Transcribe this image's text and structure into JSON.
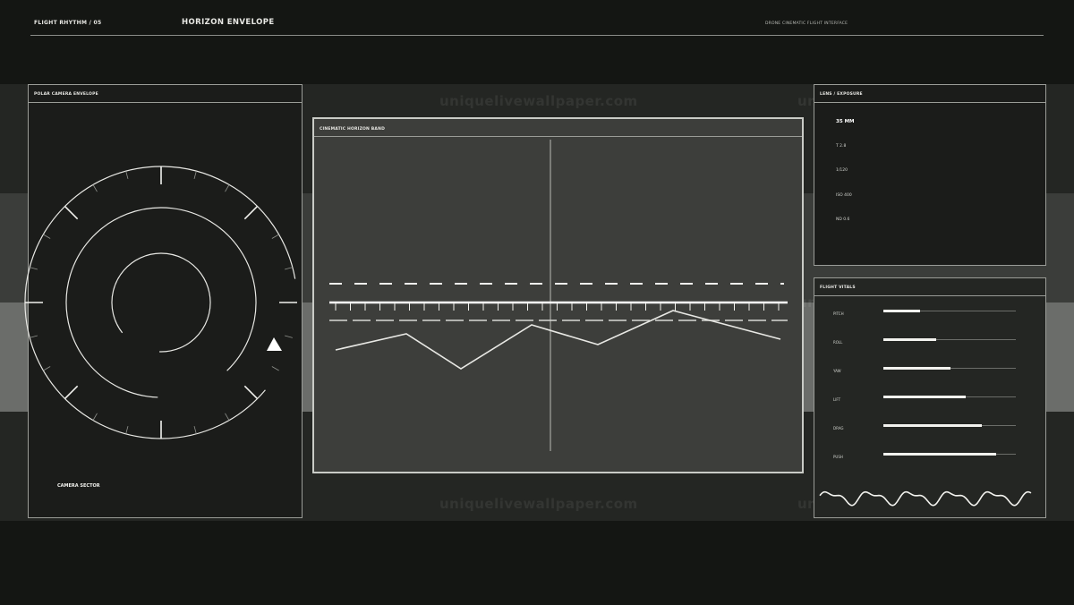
{
  "header": {
    "left_label": "FLIGHT RHYTHM / 05",
    "title": "HORIZON ENVELOPE",
    "right_label": "DRONE CINEMATIC FLIGHT INTERFACE"
  },
  "polar_panel": {
    "title": "POLAR CAMERA ENVELOPE",
    "bottom_label": "CAMERA SECTOR"
  },
  "horizon_panel": {
    "title": "CINEMATIC HORIZON BAND"
  },
  "lens_panel": {
    "title": "LENS / EXPOSURE",
    "items": [
      "35 MM",
      "T 2.8",
      "1/120",
      "ISO 400",
      "ND 0.6"
    ]
  },
  "vitals_panel": {
    "title": "FLIGHT VITALS",
    "rows": [
      {
        "label": "PITCH",
        "fraction": 0.28
      },
      {
        "label": "ROLL",
        "fraction": 0.4
      },
      {
        "label": "YAW",
        "fraction": 0.51
      },
      {
        "label": "LIFT",
        "fraction": 0.62
      },
      {
        "label": "DRAG",
        "fraction": 0.74
      },
      {
        "label": "PUSH",
        "fraction": 0.85
      }
    ]
  },
  "watermark": "uniquelivewallpaper.com",
  "colors": {
    "background": "#141613",
    "panel": "#1b1c1a",
    "center_panel": "#3d3e3b",
    "line": "#e8e8e4"
  },
  "icons": {
    "sector_marker": "triangle-icon"
  }
}
